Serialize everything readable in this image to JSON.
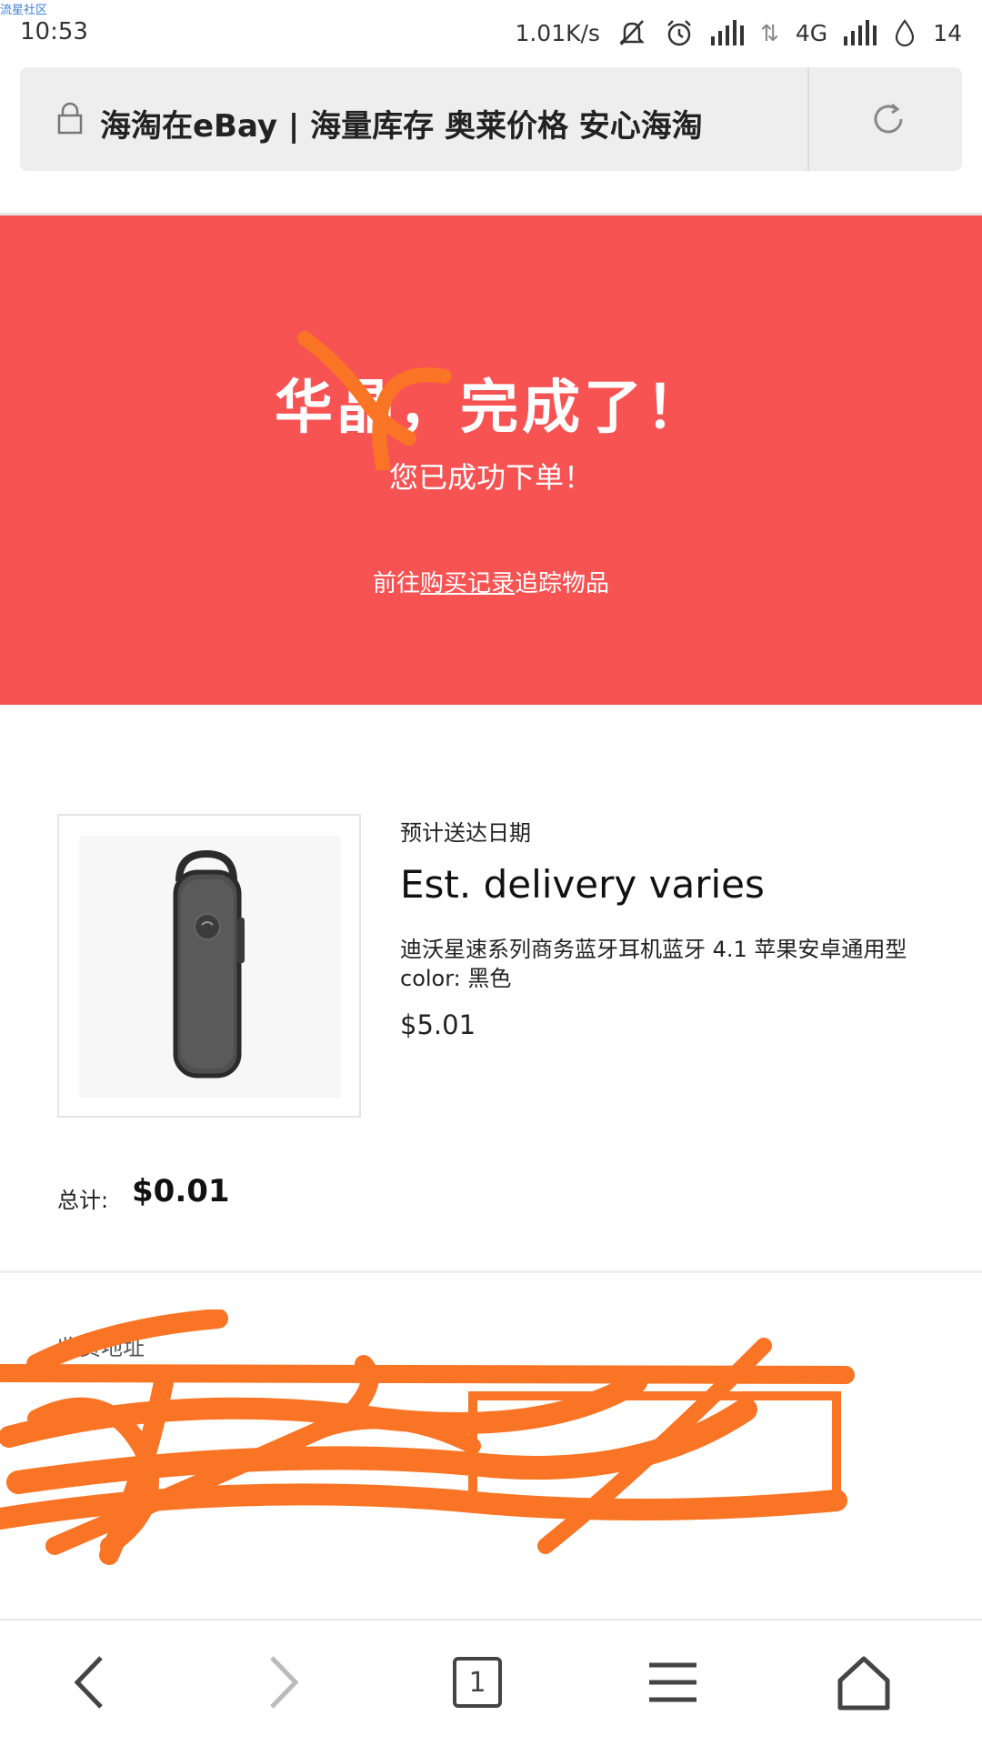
{
  "watermark": "流星社区",
  "status_bar": {
    "time": "10:53",
    "network_speed": "1.01K/s",
    "network_type": "4G",
    "battery": "14"
  },
  "browser": {
    "page_title": "海淘在eBay | 海量库存 奥莱价格 安心海淘"
  },
  "confirmation": {
    "heading": "华晶，完成了！",
    "subheading": "您已成功下单！",
    "track_prefix": "前往",
    "track_link": "购买记录",
    "track_suffix": "追踪物品"
  },
  "item": {
    "image_icon": "bluetooth-earpiece-image",
    "delivery_label": "预计送达日期",
    "delivery_value": "Est. delivery varies",
    "title": "迪沃星速系列商务蓝牙耳机蓝牙 4.1 苹果安卓通用型",
    "color": "color: 黑色",
    "price": "$5.01"
  },
  "total": {
    "label": "总计:",
    "value": "$0.01"
  },
  "shipping": {
    "heading": "收货地址"
  },
  "bottom_nav": {
    "page_count": "1"
  },
  "colors": {
    "banner": "#f75353",
    "scribble": "#f97424"
  }
}
